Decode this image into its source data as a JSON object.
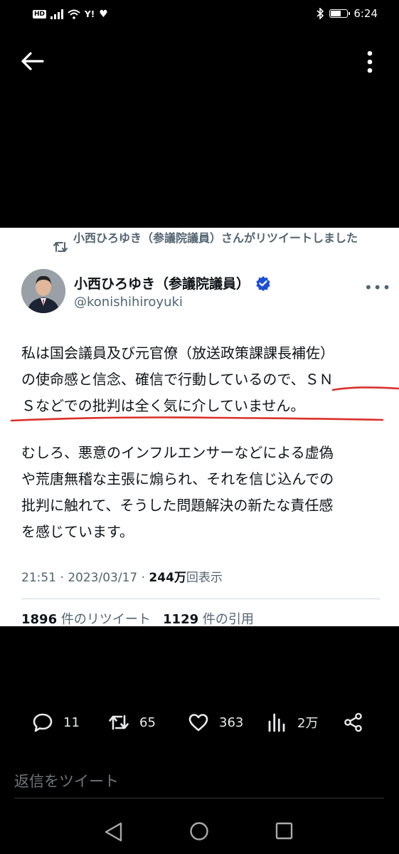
{
  "status_bar": {
    "left_badges": [
      "HD",
      "Y!"
    ],
    "time": "6:24",
    "battery_level_percent": 70
  },
  "nav": {
    "back_icon": "arrow-left-icon",
    "more_icon": "vertical-dots-icon"
  },
  "tweet": {
    "retweet_notice": "小西ひろゆき（参議院議員）さんがリツイートしました",
    "author_name": "小西ひろゆき（参議院議員）",
    "author_handle": "@konishihiroyuki",
    "more_label": "•••",
    "paragraph1_line1": "私は国会議員及び元官僚（放送政策課課長補佐）",
    "paragraph1_line2": "の使命感と信念、確信で行動しているので、ＳＮ",
    "paragraph1_line3": "Ｓなどでの批判は全く気に介していません。",
    "paragraph2_line1": "むしろ、悪意のインフルエンサーなどによる虚偽",
    "paragraph2_line2": "や荒唐無稽な主張に煽られ、それを信じ込んでの",
    "paragraph2_line3": "批判に触れて、そうした問題解決の新たな責任感",
    "paragraph2_line4": "を感じています。",
    "time": "21:51",
    "date": "2023/03/17",
    "views_count": "244万",
    "views_label": "回表示",
    "retweets_count": "1896",
    "retweets_label": "件のリツイート",
    "quotes_count": "1129",
    "quotes_label": "件の引用",
    "separator": "·"
  },
  "actions": {
    "reply_count": "11",
    "retweet_count": "65",
    "like_count": "363",
    "views_count": "2万"
  },
  "reply": {
    "placeholder": "返信をツイート"
  },
  "colors": {
    "verified": "#1d4ed8",
    "annotation_red": "#d9312b",
    "secondary_text": "#536471"
  }
}
